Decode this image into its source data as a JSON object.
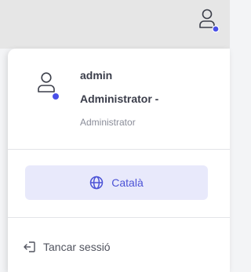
{
  "user": {
    "name": "admin",
    "role": "Administrator -",
    "role_sub": "Administrator"
  },
  "language": {
    "label": "Català",
    "icon": "globe-icon"
  },
  "logout": {
    "label": "Tancar sessió",
    "icon": "logout-icon"
  },
  "colors": {
    "accent": "#4c53d6",
    "status_dot": "#4a50e8",
    "lang_button_bg": "#e8e9fb"
  }
}
